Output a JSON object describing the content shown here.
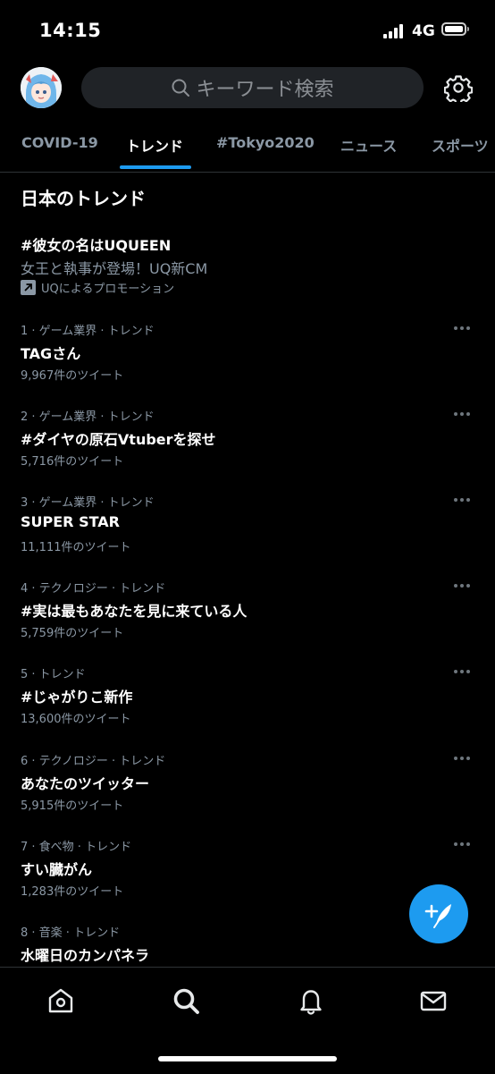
{
  "status_bar": {
    "time": "14:15",
    "network": "4G"
  },
  "search": {
    "placeholder": "キーワード検索"
  },
  "tabs": [
    {
      "label": "COVID-19"
    },
    {
      "label": "トレンド"
    },
    {
      "label": "#Tokyo2020"
    },
    {
      "label": "ニュース"
    },
    {
      "label": "スポーツ"
    }
  ],
  "active_tab": "トレンド",
  "section": {
    "title": "日本のトレンド"
  },
  "promoted": {
    "title": "#彼女の名はUQUEEN",
    "description": "女王と執事が登場！UQ新CM",
    "promoted_by": "UQによるプロモーション"
  },
  "trends": [
    {
      "meta": "1 · ゲーム業界 · トレンド",
      "name": "TAGさん",
      "count": "9,967件のツイート"
    },
    {
      "meta": "2 · ゲーム業界 · トレンド",
      "name": "#ダイヤの原石Vtuberを探せ",
      "count": "5,716件のツイート"
    },
    {
      "meta": "3 · ゲーム業界 · トレンド",
      "name": "SUPER STAR",
      "count": "11,111件のツイート"
    },
    {
      "meta": "4 · テクノロジー · トレンド",
      "name": "#実は最もあなたを見に来ている人",
      "count": "5,759件のツイート"
    },
    {
      "meta": "5 · トレンド",
      "name": "#じゃがりこ新作",
      "count": "13,600件のツイート"
    },
    {
      "meta": "6 · テクノロジー · トレンド",
      "name": "あなたのツイッター",
      "count": "5,915件のツイート"
    },
    {
      "meta": "7 · 食べ物 · トレンド",
      "name": "すい臓がん",
      "count": "1,283件のツイート"
    },
    {
      "meta": "8 · 音楽 · トレンド",
      "name": "水曜日のカンパネラ",
      "count": ""
    }
  ],
  "colors": {
    "accent": "#1d9bf0",
    "secondary_text": "#8b98a5",
    "background": "#000000"
  },
  "icons": {
    "settings": "gear-icon",
    "search": "search-icon",
    "compose": "compose-icon",
    "nav": [
      "home-icon",
      "search-icon",
      "bell-icon",
      "mail-icon"
    ]
  }
}
